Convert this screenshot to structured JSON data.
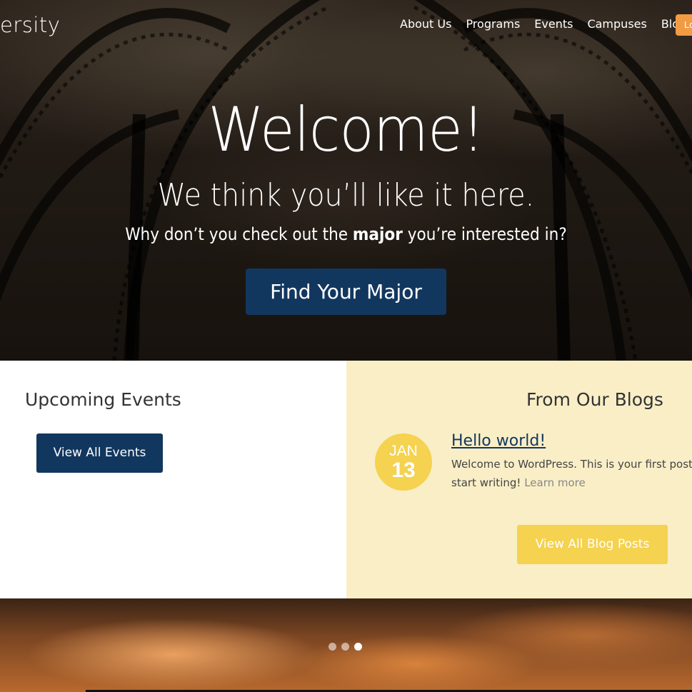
{
  "header": {
    "brand": "ersity",
    "nav": [
      "About Us",
      "Programs",
      "Events",
      "Campuses",
      "Blog"
    ],
    "login_label": "Lo"
  },
  "hero": {
    "title": "Welcome!",
    "subtitle": "We think you’ll like it here.",
    "line_before": "Why don’t you check out the ",
    "line_bold": "major",
    "line_after": " you’re interested in?",
    "cta_label": "Find Your Major"
  },
  "events": {
    "heading": "Upcoming Events",
    "button_label": "View All Events"
  },
  "blogs": {
    "heading": "From Our Blogs",
    "post": {
      "month": "JAN",
      "day": "13",
      "title": "Hello world!",
      "excerpt": "Welcome to WordPress. This is your first post. E start writing!",
      "learn_more": "Learn more"
    },
    "button_label": "View All Blog Posts"
  },
  "slider": {
    "slide_count": 3,
    "active_slide": 3
  },
  "colors": {
    "primary": "#12375f",
    "accent": "#f5d24f",
    "blog_bg": "#f9eec6",
    "login": "#f29b45"
  }
}
